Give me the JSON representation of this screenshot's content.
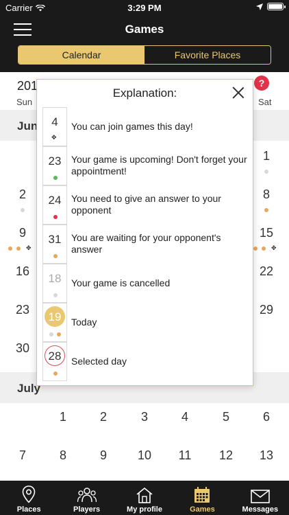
{
  "status": {
    "carrier": "Carrier",
    "time": "3:29 PM"
  },
  "nav": {
    "title": "Games"
  },
  "segments": {
    "calendar": "Calendar",
    "favorites": "Favorite Places"
  },
  "calendar": {
    "year_fragment": "201",
    "dow_sun": "Sun",
    "dow_sat": "Sat",
    "june_label": "Jun",
    "july_label": "July",
    "june_days": {
      "d1": "1",
      "d2": "2",
      "d8": "8",
      "d9": "9",
      "d15": "15",
      "d16": "16",
      "d22": "22",
      "d23": "23",
      "d29": "29",
      "d30": "30"
    },
    "july_days": [
      "1",
      "2",
      "3",
      "4",
      "5",
      "6",
      "7",
      "8",
      "9",
      "10",
      "11",
      "12",
      "13"
    ]
  },
  "help_label": "?",
  "modal": {
    "title": "Explanation:",
    "rows": [
      {
        "day": "4",
        "text": "You can join games this day!"
      },
      {
        "day": "23",
        "text": "Your game is upcoming! Don't forget your appointment!"
      },
      {
        "day": "24",
        "text": "You need to give an answer to your opponent"
      },
      {
        "day": "31",
        "text": "You are waiting for your opponent's answer"
      },
      {
        "day": "18",
        "text": "Your game is cancelled"
      },
      {
        "day": "19",
        "text": "Today"
      },
      {
        "day": "28",
        "text": "Selected day"
      }
    ]
  },
  "colors": {
    "gold": "#e9c86f",
    "dark": "#1a1a1a",
    "green": "#5cb85c",
    "red": "#e2334a",
    "orange": "#e8a85c"
  },
  "tabs": [
    {
      "label": "Places",
      "icon": "map-pin-icon"
    },
    {
      "label": "Players",
      "icon": "players-icon"
    },
    {
      "label": "My profile",
      "icon": "home-icon"
    },
    {
      "label": "Games",
      "icon": "calendar-icon"
    },
    {
      "label": "Messages",
      "icon": "envelope-icon"
    }
  ]
}
